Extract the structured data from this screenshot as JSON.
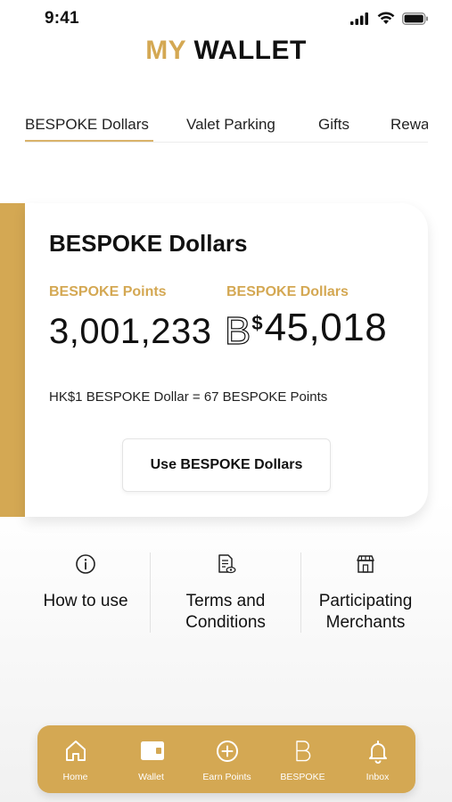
{
  "status_bar": {
    "time": "9:41",
    "icons": [
      "signal-icon",
      "wifi-icon",
      "battery-icon"
    ]
  },
  "title": {
    "part1": "MY",
    "part2": "WALLET"
  },
  "tabs": [
    {
      "label": "BESPOKE Dollars",
      "active": true
    },
    {
      "label": "Valet Parking",
      "active": false
    },
    {
      "label": "Gifts",
      "active": false
    },
    {
      "label": "Rewa",
      "active": false
    }
  ],
  "card": {
    "title": "BESPOKE Dollars",
    "points_label": "BESPOKE Points",
    "points_value": "3,001,233",
    "dollars_label": "BESPOKE Dollars",
    "dollars_currency_letter": "B",
    "dollars_currency_sign": "$",
    "dollars_value": "45,018",
    "rate_text": "HK$1 BESPOKE Dollar = 67 BESPOKE Points",
    "button_label": "Use BESPOKE Dollars"
  },
  "info_links": [
    {
      "icon": "info-icon",
      "label": "How to use"
    },
    {
      "icon": "document-icon",
      "label": "Terms and Conditions"
    },
    {
      "icon": "store-icon",
      "label": "Participating Merchants"
    }
  ],
  "bottom_nav": [
    {
      "icon": "home-icon",
      "label": "Home"
    },
    {
      "icon": "wallet-icon",
      "label": "Wallet"
    },
    {
      "icon": "plus-circle-icon",
      "label": "Earn Points"
    },
    {
      "icon": "bespoke-b-icon",
      "label": "BESPOKE"
    },
    {
      "icon": "bell-icon",
      "label": "Inbox"
    }
  ],
  "colors": {
    "accent": "#d4a853",
    "text": "#111111",
    "nav_text": "#ffffff"
  }
}
